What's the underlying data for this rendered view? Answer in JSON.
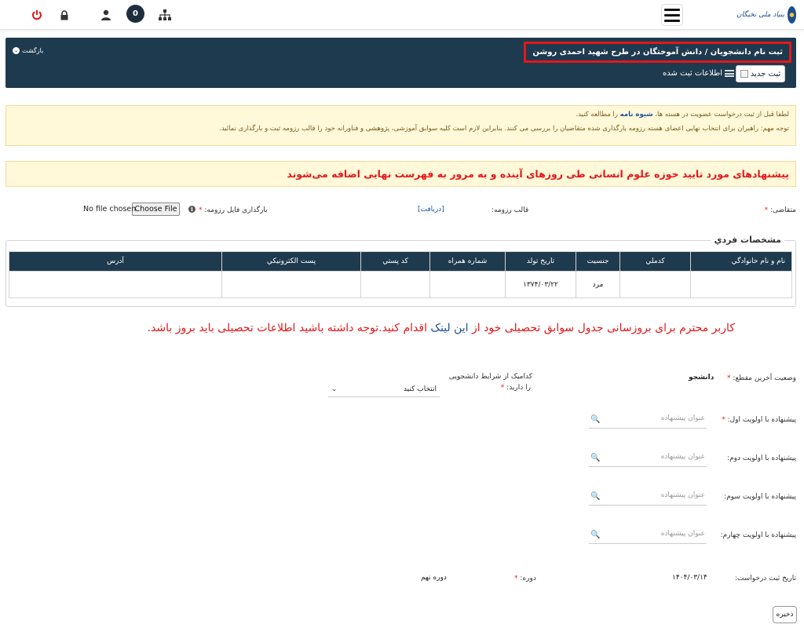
{
  "topbar": {
    "badge_count": "0",
    "icons": [
      "power-icon",
      "lock-icon",
      "user-icon",
      "sitemap-icon"
    ],
    "logo_text": "بنیاد ملی نخبگان"
  },
  "header": {
    "title": "ثبت نام دانشجویان / دانش آموختگان در طرح شهید احمدی روشن",
    "back_label": "بازگشت",
    "new_button_label": "ثبت جدید",
    "registered_link_label": "اطلاعات ثبت شده"
  },
  "notice": {
    "line1_before": "لطفا قبل از ثبت درخواست عضویت در هسته ها،",
    "line1_link": "شیوه نامه",
    "line1_after": "را مطالعه کنید.",
    "line2": "توجه مهم: راهبران برای انتخاب نهایی اعضای هسته رزومه بارگذاری شده متقاضیان را بررسی می کنند. بنابراین لازم است کلیه سوابق آموزشی، پژوهشی و فناورانه خود را قالب رزومه ثبت و بارگذاری نمائید."
  },
  "announcement": "پیشنهادهای مورد تایید حوزه علوم انسانی طی روزهای آینده و به مرور به فهرست نهایی اضافه می‌شوند",
  "applicant_row": {
    "applicant_label": "متقاضی:",
    "resume_template_label": "قالب رزومه:",
    "receive_link": "[دریافت]",
    "upload_label": "بارگذاري فايل رزومه:",
    "choose_file": "Choose File",
    "no_file": "No file chosen"
  },
  "personal": {
    "legend": "مشخصات فردي",
    "columns": [
      "نام و نام خانوادگي",
      "کدملي",
      "جنسيت",
      "تاريخ تولد",
      "شماره همراه",
      "کد پستي",
      "پست الکترونيکي",
      "آدرس"
    ],
    "row": [
      "",
      "",
      "مرد",
      "۱۳۷۴/۰۳/۲۲",
      "",
      "",
      "",
      ""
    ]
  },
  "red_message": {
    "before": "کاربر محترم برای بروزسانی جدول سوابق تحصیلی خود از",
    "link": "این لینک",
    "after": "اقدام کنید.توجه داشته باشید اطلاعات تحصیلی باید بروز باشد."
  },
  "education": {
    "status_label": "وضعیت آخرین مقطع:",
    "status_value": "دانشجو",
    "condition_label_1": "کدامیک از شرایط دانشجویی",
    "condition_label_2": "را دارید:",
    "condition_selected": "انتخاب کنید"
  },
  "proposals": [
    {
      "label": "پیشنهاده با اولویت اول:",
      "placeholder": "عنوان پیشنهاده",
      "required": true
    },
    {
      "label": "پیشنهاده با اولویت دوم:",
      "placeholder": "عنوان پیشنهاده",
      "required": false
    },
    {
      "label": "پیشنهاده با اولویت سوم:",
      "placeholder": "عنوان پیشنهاده",
      "required": false
    },
    {
      "label": "پیشنهاده با اولویت چهارم:",
      "placeholder": "عنوان پیشنهاده",
      "required": false
    }
  ],
  "request": {
    "date_label": "تاریخ ثبت درخواست:",
    "date_value": "۱۴۰۴/۰۳/۱۴",
    "period_label": "دوره:",
    "period_value": "دوره نهم"
  },
  "save_label": "ذخیره"
}
